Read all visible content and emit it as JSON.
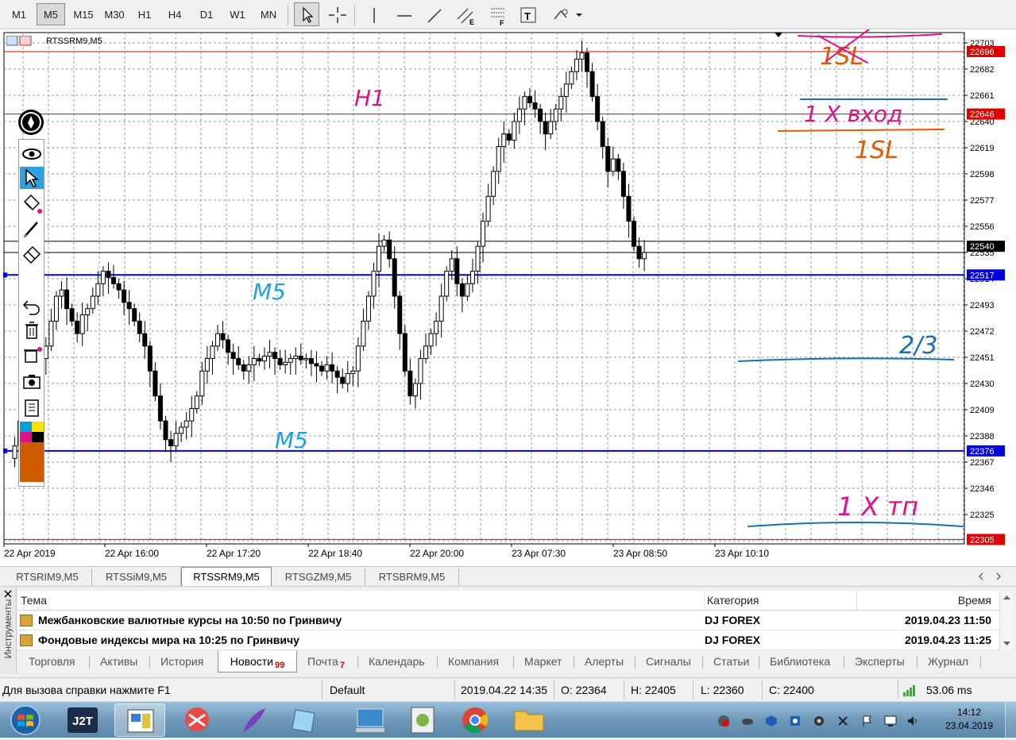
{
  "toolbar": {
    "timeframes": [
      "M1",
      "M5",
      "M15",
      "M30",
      "H1",
      "H4",
      "D1",
      "W1",
      "MN"
    ],
    "active_timeframe": "M5",
    "tools": [
      "cursor-icon",
      "crosshair-icon",
      "vertical-line-icon",
      "horizontal-line-icon",
      "trendline-icon",
      "equidistant-channel-icon",
      "fibonacci-icon",
      "text-icon",
      "shapes-icon"
    ]
  },
  "chart": {
    "symbol_title": "RTSSRM9,M5",
    "price_axis": [
      "22703",
      "22682",
      "22661",
      "22640",
      "22619",
      "22598",
      "22577",
      "22556",
      "22535",
      "22514",
      "22493",
      "22472",
      "22451",
      "22430",
      "22409",
      "22388",
      "22367",
      "22346",
      "22325"
    ],
    "time_axis": [
      "22 Apr 2019",
      "22 Apr 16:00",
      "22 Apr 17:20",
      "22 Apr 18:40",
      "22 Apr 20:00",
      "23 Apr 07:30",
      "23 Apr 08:50",
      "23 Apr 10:10"
    ],
    "price_tags": [
      {
        "label": "22696",
        "color": "#e00000"
      },
      {
        "label": "22646",
        "color": "#e00000"
      },
      {
        "label": "22540",
        "color": "#000000"
      },
      {
        "label": "22517",
        "color": "#0000e0"
      },
      {
        "label": "22376",
        "color": "#0000e0"
      },
      {
        "label": "22305",
        "color": "#e00000"
      }
    ],
    "annotations": {
      "h1": "H1",
      "m5_upper": "M5",
      "m5_lower": "M5",
      "entry": "1 X вход",
      "sl1": "1SL",
      "sl_top": "1SL",
      "tp_two_thirds": "2/3",
      "tp": "1 X тп"
    }
  },
  "chart_tabs": [
    "RTSRIM9,M5",
    "RTSSiM9,M5",
    "RTSSRM9,M5",
    "RTSGZM9,M5",
    "RTSBRM9,M5"
  ],
  "active_chart_tab": "RTSSRM9,M5",
  "terminal": {
    "side_label": "Инструменты",
    "columns": {
      "topic": "Тема",
      "category": "Категория",
      "time": "Время"
    },
    "rows": [
      {
        "topic": "Межбанковские валютные курсы на 10:50 по Гринвичу",
        "category": "DJ FOREX",
        "time": "2019.04.23 11:50"
      },
      {
        "topic": "Фондовые индексы мира на 10:25 по Гринвичу",
        "category": "DJ FOREX",
        "time": "2019.04.23 11:25"
      }
    ],
    "tabs": [
      {
        "label": "Торговля",
        "badge": ""
      },
      {
        "label": "Активы",
        "badge": ""
      },
      {
        "label": "История",
        "badge": ""
      },
      {
        "label": "Новости",
        "badge": "99"
      },
      {
        "label": "Почта",
        "badge": "7"
      },
      {
        "label": "Календарь",
        "badge": ""
      },
      {
        "label": "Компания",
        "badge": ""
      },
      {
        "label": "Маркет",
        "badge": ""
      },
      {
        "label": "Алерты",
        "badge": ""
      },
      {
        "label": "Сигналы",
        "badge": ""
      },
      {
        "label": "Статьи",
        "badge": ""
      },
      {
        "label": "Библиотека",
        "badge": ""
      },
      {
        "label": "Эксперты",
        "badge": ""
      },
      {
        "label": "Журнал",
        "badge": ""
      }
    ],
    "active_tab": "Новости"
  },
  "status": {
    "help": "Для вызова справки нажмите F1",
    "profile": "Default",
    "datetime": "2019.04.22 14:35",
    "open": "O: 22364",
    "high": "H: 22405",
    "low": "L: 22360",
    "close": "C: 22400",
    "ping": "53.06 ms"
  },
  "taskbar": {
    "apps": [
      "windows-start-icon",
      "j2t-app-icon",
      "terminal-app-icon",
      "snipping-tool-icon",
      "feather-app-icon",
      "notepad-app-icon",
      "computer-app-icon",
      "file-app-icon",
      "chrome-app-icon",
      "folder-app-icon"
    ],
    "j2t_label": "J2T",
    "time": "14:12",
    "date": "23.04.2019"
  }
}
